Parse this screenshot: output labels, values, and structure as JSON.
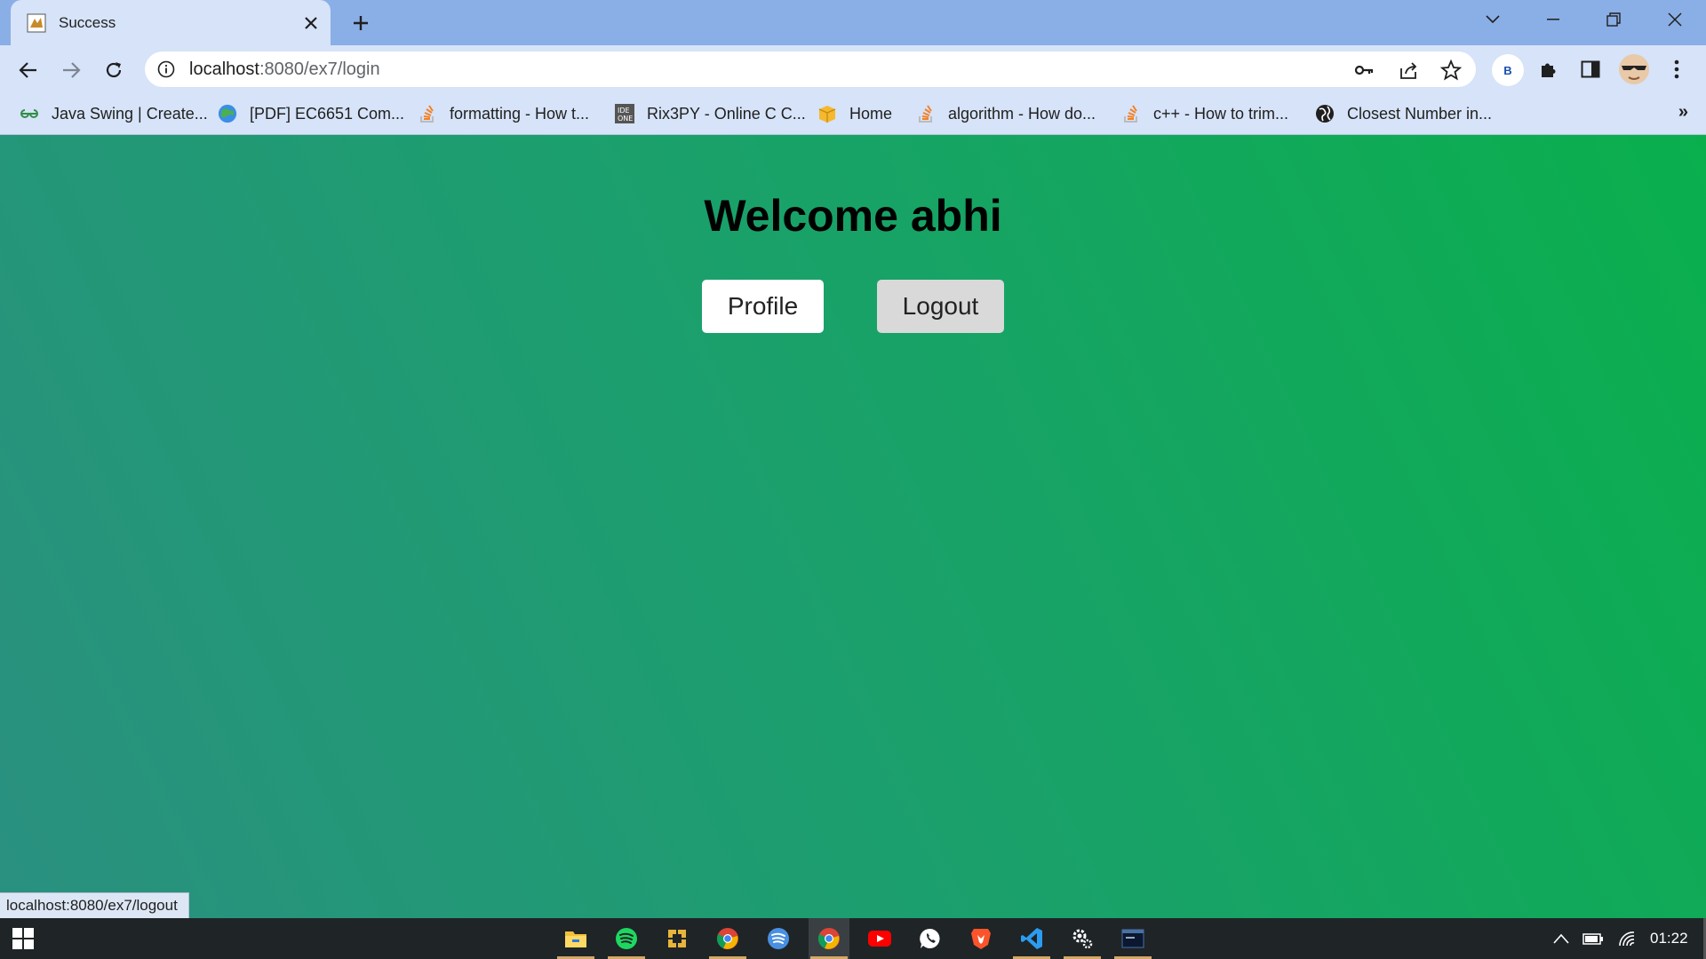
{
  "browser": {
    "tab_title": "Success",
    "url_host": "localhost",
    "url_path": ":8080/ex7/login"
  },
  "bookmarks": [
    {
      "label": "Java Swing | Create...",
      "icon": "geeksforgeeks-icon"
    },
    {
      "label": "[PDF] EC6651 Com...",
      "icon": "globe-colored-icon"
    },
    {
      "label": "formatting - How t...",
      "icon": "stackoverflow-icon"
    },
    {
      "label": "Rix3PY - Online C C...",
      "icon": "ideone-icon"
    },
    {
      "label": "Home",
      "icon": "box-icon"
    },
    {
      "label": "algorithm - How do...",
      "icon": "stackoverflow-icon"
    },
    {
      "label": "c++ - How to trim...",
      "icon": "stackoverflow-icon"
    },
    {
      "label": "Closest Number in...",
      "icon": "globe-icon"
    }
  ],
  "page": {
    "welcome_prefix": "Welcome ",
    "username": "abhi",
    "profile_label": "Profile",
    "logout_label": "Logout",
    "gradient_start": "#2a9080",
    "gradient_end": "#0aaf4d"
  },
  "status_bar": {
    "url": "localhost:8080/ex7/logout"
  },
  "profile_badge": "B",
  "taskbar": {
    "clock": "01:22",
    "apps": [
      "file-explorer-icon",
      "spotify-icon",
      "app-icon",
      "chrome-icon",
      "spotify-browser-icon",
      "chrome-active-icon",
      "youtube-icon",
      "whatsapp-icon",
      "brave-icon",
      "vscode-icon",
      "settings-icon",
      "terminal-icon"
    ]
  }
}
